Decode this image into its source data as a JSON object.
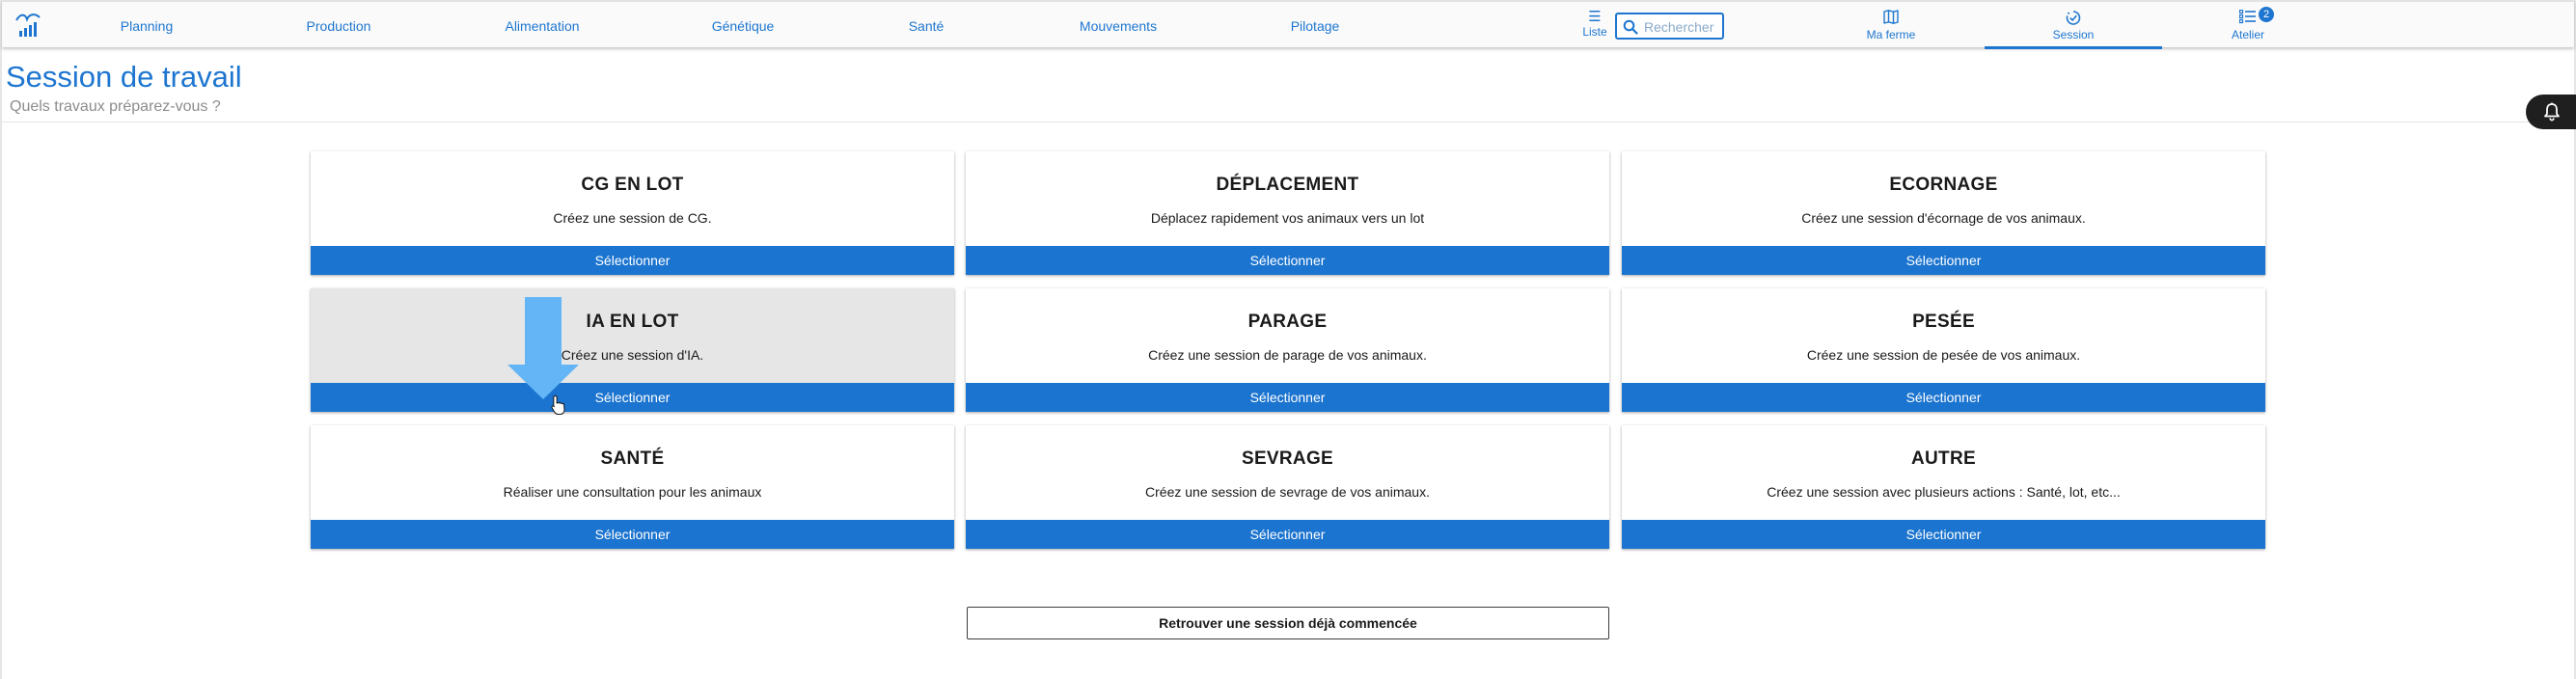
{
  "nav": {
    "items": [
      {
        "label": "Planning"
      },
      {
        "label": "Production"
      },
      {
        "label": "Alimentation"
      },
      {
        "label": "Génétique"
      },
      {
        "label": "Santé"
      },
      {
        "label": "Mouvements"
      },
      {
        "label": "Pilotage"
      }
    ],
    "liste_label": "Liste",
    "search_placeholder": "Rechercher",
    "search_value": "",
    "tabs": {
      "ferme": {
        "label": "Ma ferme"
      },
      "session": {
        "label": "Session",
        "active": true
      },
      "atelier": {
        "label": "Atelier",
        "badge": "2"
      }
    }
  },
  "header": {
    "title": "Session de travail",
    "subtitle": "Quels travaux préparez-vous ?"
  },
  "cards": [
    {
      "title": "CG EN LOT",
      "description": "Créez une session de CG.",
      "button": "Sélectionner"
    },
    {
      "title": "DÉPLACEMENT",
      "description": "Déplacez rapidement vos animaux vers un lot",
      "button": "Sélectionner"
    },
    {
      "title": "ECORNAGE",
      "description": "Créez une session d'écornage de vos animaux.",
      "button": "Sélectionner"
    },
    {
      "title": "IA EN LOT",
      "description": "Créez une session d'IA.",
      "button": "Sélectionner",
      "highlighted": true
    },
    {
      "title": "PARAGE",
      "description": "Créez une session de parage de vos animaux.",
      "button": "Sélectionner"
    },
    {
      "title": "PESÉE",
      "description": "Créez une session de pesée de vos animaux.",
      "button": "Sélectionner"
    },
    {
      "title": "SANTÉ",
      "description": "Réaliser une consultation pour les animaux",
      "button": "Sélectionner"
    },
    {
      "title": "SEVRAGE",
      "description": "Créez une session de sevrage de vos animaux.",
      "button": "Sélectionner"
    },
    {
      "title": "AUTRE",
      "description": "Créez une session avec plusieurs actions : Santé, lot, etc...",
      "button": "Sélectionner"
    }
  ],
  "resume_button": "Retrouver une session déjà commencée",
  "colors": {
    "primary": "#1b74cf",
    "link": "#1e76d0",
    "highlight_card": "#e6e6e6",
    "overlay_arrow": "#64b5f6",
    "notification": "#1f1f1f"
  },
  "icons": {
    "logo": "farm-chart-logo",
    "liste": "list-icon",
    "search": "search-icon",
    "ferme": "map-icon",
    "session": "timer-check-icon",
    "atelier": "checklist-icon",
    "notification": "bell-icon",
    "cursor": "hand-pointer-icon"
  }
}
